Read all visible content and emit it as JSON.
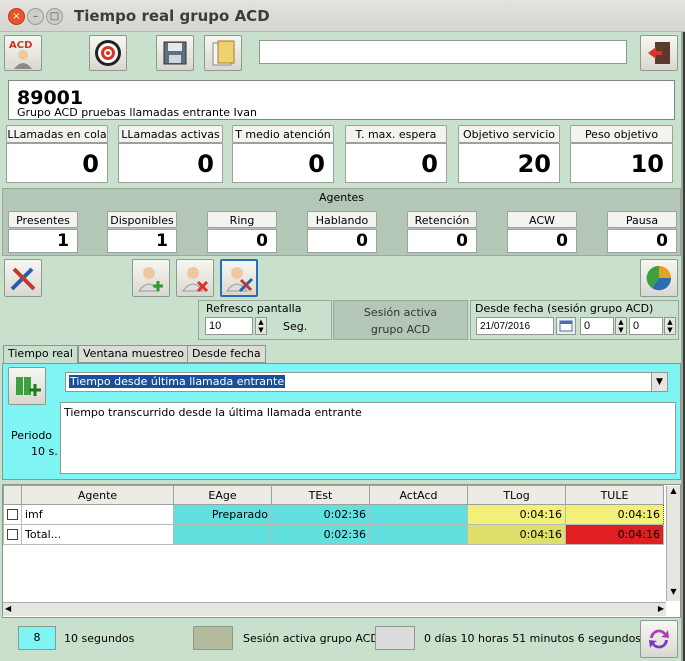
{
  "window": {
    "title": "Tiempo real grupo ACD"
  },
  "toolbar": {
    "acd_icon_label": "ACD",
    "search_value": "",
    "icons": [
      "acd-agent-icon",
      "target-icon",
      "save-icon",
      "export-icon",
      "exit-icon"
    ]
  },
  "group": {
    "id": "89001",
    "name": "Grupo ACD pruebas llamadas entrante Ivan"
  },
  "kpis": [
    {
      "label": "LLamadas en cola",
      "value": "0"
    },
    {
      "label": "LLamadas activas",
      "value": "0"
    },
    {
      "label": "T medio atención",
      "value": "0"
    },
    {
      "label": "T. max. espera",
      "value": "0"
    },
    {
      "label": "Objetivo servicio",
      "value": "20"
    },
    {
      "label": "Peso objetivo",
      "value": "10"
    }
  ],
  "agents": {
    "title": "Agentes",
    "stats": [
      {
        "label": "Presentes",
        "value": "1"
      },
      {
        "label": "Disponibles",
        "value": "1"
      },
      {
        "label": "Ring",
        "value": "0"
      },
      {
        "label": "Hablando",
        "value": "0"
      },
      {
        "label": "Retención",
        "value": "0"
      },
      {
        "label": "ACW",
        "value": "0"
      },
      {
        "label": "Pausa",
        "value": "0"
      }
    ]
  },
  "refresh": {
    "label": "Refresco pantalla",
    "value": "10",
    "unit": "Seg."
  },
  "session": {
    "label": "Sesión activa grupo ACD"
  },
  "date_filter": {
    "label": "Desde fecha (sesión grupo ACD)",
    "date": "21/07/2016",
    "hour": "0",
    "minute": "0"
  },
  "tabs": [
    "Tiempo real",
    "Ventana muestreo",
    "Desde fecha"
  ],
  "period": {
    "label": "Periodo",
    "value": "10 s."
  },
  "metric": {
    "selected": "Tiempo desde última llamada entrante",
    "description": "Tiempo transcurrido desde la última llamada entrante"
  },
  "table": {
    "columns": [
      "Agente",
      "EAge",
      "TEst",
      "ActAcd",
      "TLog",
      "TULE"
    ],
    "rows": [
      [
        "imf",
        "Preparado",
        "0:02:36",
        "",
        "0:04:16",
        "0:04:16"
      ],
      [
        "Total...",
        "",
        "0:02:36",
        "",
        "0:04:16",
        "0:04:16"
      ]
    ]
  },
  "status": {
    "count": "8",
    "interval": "10 segundos",
    "session": "Sesión activa grupo ACD",
    "elapsed": "0 días 10 horas 51 minutos 6 segundos"
  },
  "colors": {
    "panel": "#c9e0cc",
    "cyan": "#62e0e0",
    "yellow": "#f3f07a",
    "olive": "#dede6a",
    "red": "#e02020",
    "status_cyan": "#7ff4f4"
  }
}
